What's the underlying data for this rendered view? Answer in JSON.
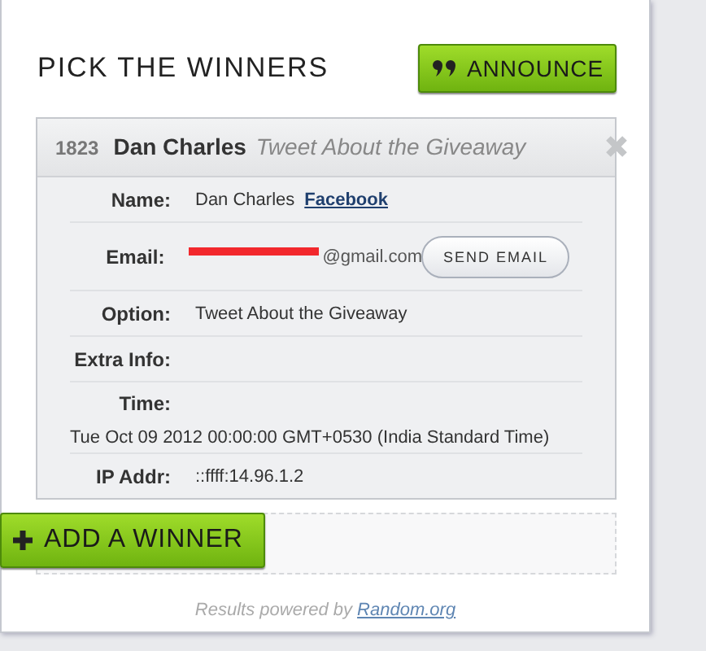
{
  "title": "PICK THE WINNERS",
  "announce_button": "ANNOUNCE",
  "entry": {
    "id": "1823",
    "name": "Dan Charles",
    "option": "Tweet About the Giveaway",
    "rows": [
      {
        "kind": "name",
        "label": "Name:",
        "value": "Dan Charles",
        "link": "Facebook"
      },
      {
        "kind": "email",
        "label": "Email:",
        "value": "@gmail.com",
        "redacted": true,
        "button": "SEND EMAIL"
      },
      {
        "kind": "text",
        "label": "Option:",
        "value": "Tweet About the Giveaway"
      },
      {
        "kind": "text",
        "label": "Extra Info:"
      },
      {
        "kind": "block",
        "label": "Time:",
        "value": "Tue Oct 09 2012 00:00:00 GMT+0530 (India Standard Time)"
      },
      {
        "kind": "text",
        "label": "IP Addr:",
        "value": "::ffff:14.96.1.2"
      }
    ]
  },
  "add_button": "ADD A WINNER",
  "footer": {
    "text": "Results powered by",
    "link": "Random.org"
  }
}
